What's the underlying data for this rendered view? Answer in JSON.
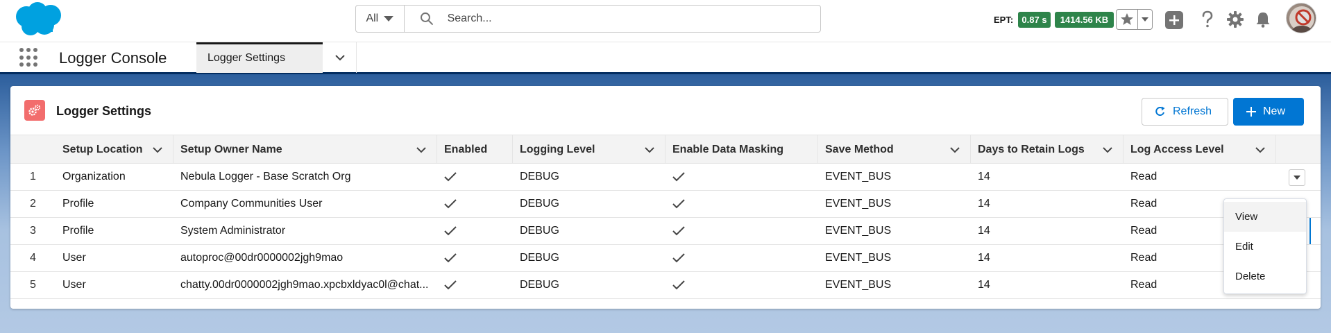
{
  "header": {
    "search": {
      "scope": "All",
      "placeholder": "Search..."
    },
    "ept": {
      "label": "EPT:",
      "time": "0.87 s",
      "size": "1414.56 KB"
    }
  },
  "nav": {
    "app_name": "Logger Console",
    "tabs": [
      {
        "label": "Logger Settings"
      }
    ]
  },
  "card": {
    "title": "Logger Settings",
    "refresh_label": "Refresh",
    "new_label": "New",
    "columns": [
      "Setup Location",
      "Setup Owner Name",
      "Enabled",
      "Logging Level",
      "Enable Data Masking",
      "Save Method",
      "Days to Retain Logs",
      "Log Access Level"
    ],
    "rows": [
      {
        "num": "1",
        "location": "Organization",
        "owner": "Nebula Logger - Base Scratch Org",
        "logging_level": "DEBUG",
        "save_method": "EVENT_BUS",
        "days": "14",
        "access": "Read"
      },
      {
        "num": "2",
        "location": "Profile",
        "owner": "Company Communities User",
        "logging_level": "DEBUG",
        "save_method": "EVENT_BUS",
        "days": "14",
        "access": "Read"
      },
      {
        "num": "3",
        "location": "Profile",
        "owner": "System Administrator",
        "logging_level": "DEBUG",
        "save_method": "EVENT_BUS",
        "days": "14",
        "access": "Read"
      },
      {
        "num": "4",
        "location": "User",
        "owner": "autoproc@00dr0000002jgh9mao",
        "logging_level": "DEBUG",
        "save_method": "EVENT_BUS",
        "days": "14",
        "access": "Read"
      },
      {
        "num": "5",
        "location": "User",
        "owner": "chatty.00dr0000002jgh9mao.xpcbxldyac0l@chat...",
        "logging_level": "DEBUG",
        "save_method": "EVENT_BUS",
        "days": "14",
        "access": "Read"
      }
    ]
  },
  "row_menu": {
    "items": [
      "View",
      "Edit",
      "Delete"
    ]
  },
  "colors": {
    "brand": "#0176d3",
    "badge_green": "#2e844a",
    "icon_red": "#f26d6d",
    "nav_border": "#032d60"
  }
}
